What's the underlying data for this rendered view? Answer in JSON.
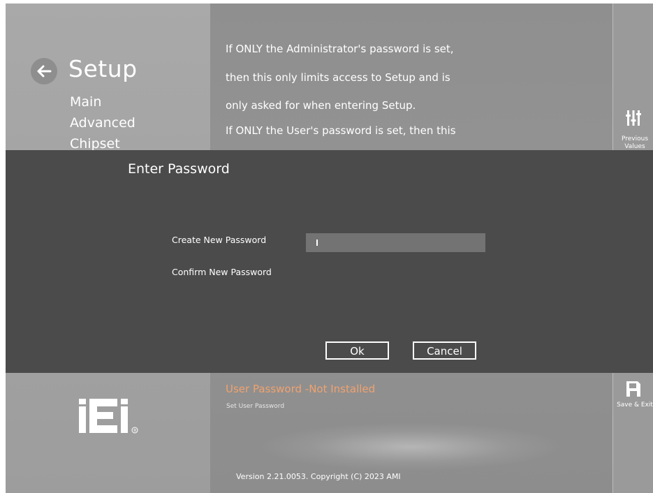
{
  "sidebar": {
    "title": "Setup",
    "menu": [
      "Main",
      "Advanced",
      "Chipset"
    ]
  },
  "help_text": [
    "If ONLY the Administrator's password is set,",
    "then this only limits access to Setup and is",
    "only asked for when entering Setup.",
    "If ONLY the User's password is set, then this"
  ],
  "right_bar": {
    "previous_values_label": "Previous Values",
    "save_exit_label": "Save & Exit"
  },
  "dialog": {
    "title": "Enter Password",
    "create_label": "Create New Password",
    "confirm_label": "Confirm New Password",
    "create_value": "",
    "ok_label": "Ok",
    "cancel_label": "Cancel"
  },
  "item": {
    "title": "User Password -Not Installed",
    "description": "Set User Password"
  },
  "footer": {
    "version": "Version 2.21.0053. Copyright (C) 2023 AMI"
  },
  "logo_text": "iEi",
  "colors": {
    "dialog_bg": "#4b4b4b",
    "accent_orange": "#f0a26f",
    "input_bg": "#737373"
  }
}
